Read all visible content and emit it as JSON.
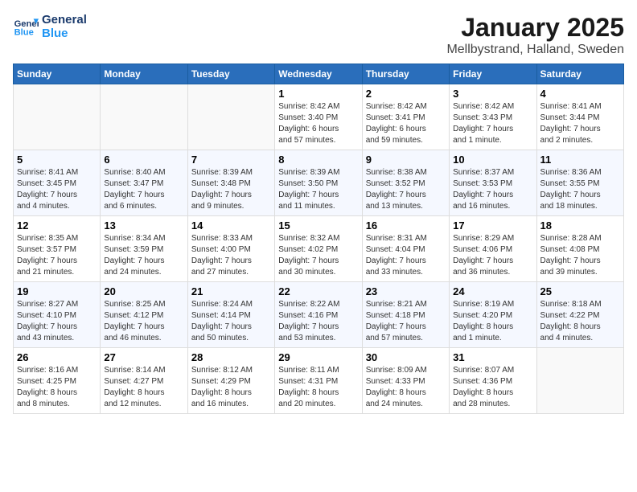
{
  "header": {
    "logo_line1": "General",
    "logo_line2": "Blue",
    "month_title": "January 2025",
    "location": "Mellbystrand, Halland, Sweden"
  },
  "weekdays": [
    "Sunday",
    "Monday",
    "Tuesday",
    "Wednesday",
    "Thursday",
    "Friday",
    "Saturday"
  ],
  "weeks": [
    [
      {
        "day": "",
        "info": ""
      },
      {
        "day": "",
        "info": ""
      },
      {
        "day": "",
        "info": ""
      },
      {
        "day": "1",
        "info": "Sunrise: 8:42 AM\nSunset: 3:40 PM\nDaylight: 6 hours\nand 57 minutes."
      },
      {
        "day": "2",
        "info": "Sunrise: 8:42 AM\nSunset: 3:41 PM\nDaylight: 6 hours\nand 59 minutes."
      },
      {
        "day": "3",
        "info": "Sunrise: 8:42 AM\nSunset: 3:43 PM\nDaylight: 7 hours\nand 1 minute."
      },
      {
        "day": "4",
        "info": "Sunrise: 8:41 AM\nSunset: 3:44 PM\nDaylight: 7 hours\nand 2 minutes."
      }
    ],
    [
      {
        "day": "5",
        "info": "Sunrise: 8:41 AM\nSunset: 3:45 PM\nDaylight: 7 hours\nand 4 minutes."
      },
      {
        "day": "6",
        "info": "Sunrise: 8:40 AM\nSunset: 3:47 PM\nDaylight: 7 hours\nand 6 minutes."
      },
      {
        "day": "7",
        "info": "Sunrise: 8:39 AM\nSunset: 3:48 PM\nDaylight: 7 hours\nand 9 minutes."
      },
      {
        "day": "8",
        "info": "Sunrise: 8:39 AM\nSunset: 3:50 PM\nDaylight: 7 hours\nand 11 minutes."
      },
      {
        "day": "9",
        "info": "Sunrise: 8:38 AM\nSunset: 3:52 PM\nDaylight: 7 hours\nand 13 minutes."
      },
      {
        "day": "10",
        "info": "Sunrise: 8:37 AM\nSunset: 3:53 PM\nDaylight: 7 hours\nand 16 minutes."
      },
      {
        "day": "11",
        "info": "Sunrise: 8:36 AM\nSunset: 3:55 PM\nDaylight: 7 hours\nand 18 minutes."
      }
    ],
    [
      {
        "day": "12",
        "info": "Sunrise: 8:35 AM\nSunset: 3:57 PM\nDaylight: 7 hours\nand 21 minutes."
      },
      {
        "day": "13",
        "info": "Sunrise: 8:34 AM\nSunset: 3:59 PM\nDaylight: 7 hours\nand 24 minutes."
      },
      {
        "day": "14",
        "info": "Sunrise: 8:33 AM\nSunset: 4:00 PM\nDaylight: 7 hours\nand 27 minutes."
      },
      {
        "day": "15",
        "info": "Sunrise: 8:32 AM\nSunset: 4:02 PM\nDaylight: 7 hours\nand 30 minutes."
      },
      {
        "day": "16",
        "info": "Sunrise: 8:31 AM\nSunset: 4:04 PM\nDaylight: 7 hours\nand 33 minutes."
      },
      {
        "day": "17",
        "info": "Sunrise: 8:29 AM\nSunset: 4:06 PM\nDaylight: 7 hours\nand 36 minutes."
      },
      {
        "day": "18",
        "info": "Sunrise: 8:28 AM\nSunset: 4:08 PM\nDaylight: 7 hours\nand 39 minutes."
      }
    ],
    [
      {
        "day": "19",
        "info": "Sunrise: 8:27 AM\nSunset: 4:10 PM\nDaylight: 7 hours\nand 43 minutes."
      },
      {
        "day": "20",
        "info": "Sunrise: 8:25 AM\nSunset: 4:12 PM\nDaylight: 7 hours\nand 46 minutes."
      },
      {
        "day": "21",
        "info": "Sunrise: 8:24 AM\nSunset: 4:14 PM\nDaylight: 7 hours\nand 50 minutes."
      },
      {
        "day": "22",
        "info": "Sunrise: 8:22 AM\nSunset: 4:16 PM\nDaylight: 7 hours\nand 53 minutes."
      },
      {
        "day": "23",
        "info": "Sunrise: 8:21 AM\nSunset: 4:18 PM\nDaylight: 7 hours\nand 57 minutes."
      },
      {
        "day": "24",
        "info": "Sunrise: 8:19 AM\nSunset: 4:20 PM\nDaylight: 8 hours\nand 1 minute."
      },
      {
        "day": "25",
        "info": "Sunrise: 8:18 AM\nSunset: 4:22 PM\nDaylight: 8 hours\nand 4 minutes."
      }
    ],
    [
      {
        "day": "26",
        "info": "Sunrise: 8:16 AM\nSunset: 4:25 PM\nDaylight: 8 hours\nand 8 minutes."
      },
      {
        "day": "27",
        "info": "Sunrise: 8:14 AM\nSunset: 4:27 PM\nDaylight: 8 hours\nand 12 minutes."
      },
      {
        "day": "28",
        "info": "Sunrise: 8:12 AM\nSunset: 4:29 PM\nDaylight: 8 hours\nand 16 minutes."
      },
      {
        "day": "29",
        "info": "Sunrise: 8:11 AM\nSunset: 4:31 PM\nDaylight: 8 hours\nand 20 minutes."
      },
      {
        "day": "30",
        "info": "Sunrise: 8:09 AM\nSunset: 4:33 PM\nDaylight: 8 hours\nand 24 minutes."
      },
      {
        "day": "31",
        "info": "Sunrise: 8:07 AM\nSunset: 4:36 PM\nDaylight: 8 hours\nand 28 minutes."
      },
      {
        "day": "",
        "info": ""
      }
    ]
  ]
}
